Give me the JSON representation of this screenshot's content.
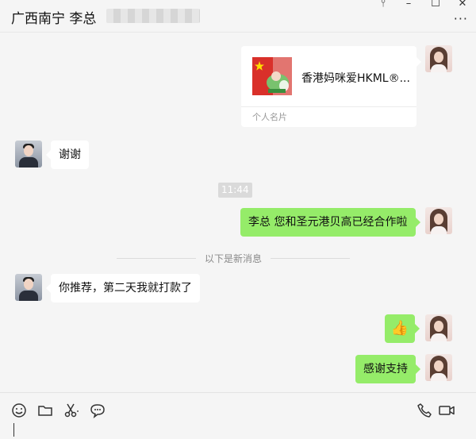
{
  "header": {
    "title": "广西南宁 李总",
    "controls": {
      "pin_icon": "pin-icon",
      "minimize_icon": "minimize-icon",
      "maximize_icon": "maximize-icon",
      "close_icon": "close-icon",
      "pin_glyph": "⫯",
      "minimize_glyph": "–",
      "maximize_glyph": "☐",
      "close_glyph": "✕"
    },
    "more_glyph": "···"
  },
  "messages": {
    "card": {
      "name": "香港妈咪爱HKML®...",
      "type_label": "个人名片"
    },
    "m1": "谢谢",
    "timestamp": "11:44",
    "m2": "李总 您和圣元港贝高已经合作啦",
    "new_divider": "以下是新消息",
    "m3": "你推荐，第二天我就打款了",
    "m4_emoji": "👍",
    "m5": "感谢支持"
  },
  "toolbar": {
    "icons": [
      "emoji-icon",
      "folder-icon",
      "scissors-icon",
      "chat-bubble-icon",
      "phone-icon",
      "video-icon"
    ]
  },
  "colors": {
    "outgoing_bubble": "#95ec69",
    "incoming_bubble": "#ffffff",
    "background": "#f5f5f5"
  }
}
